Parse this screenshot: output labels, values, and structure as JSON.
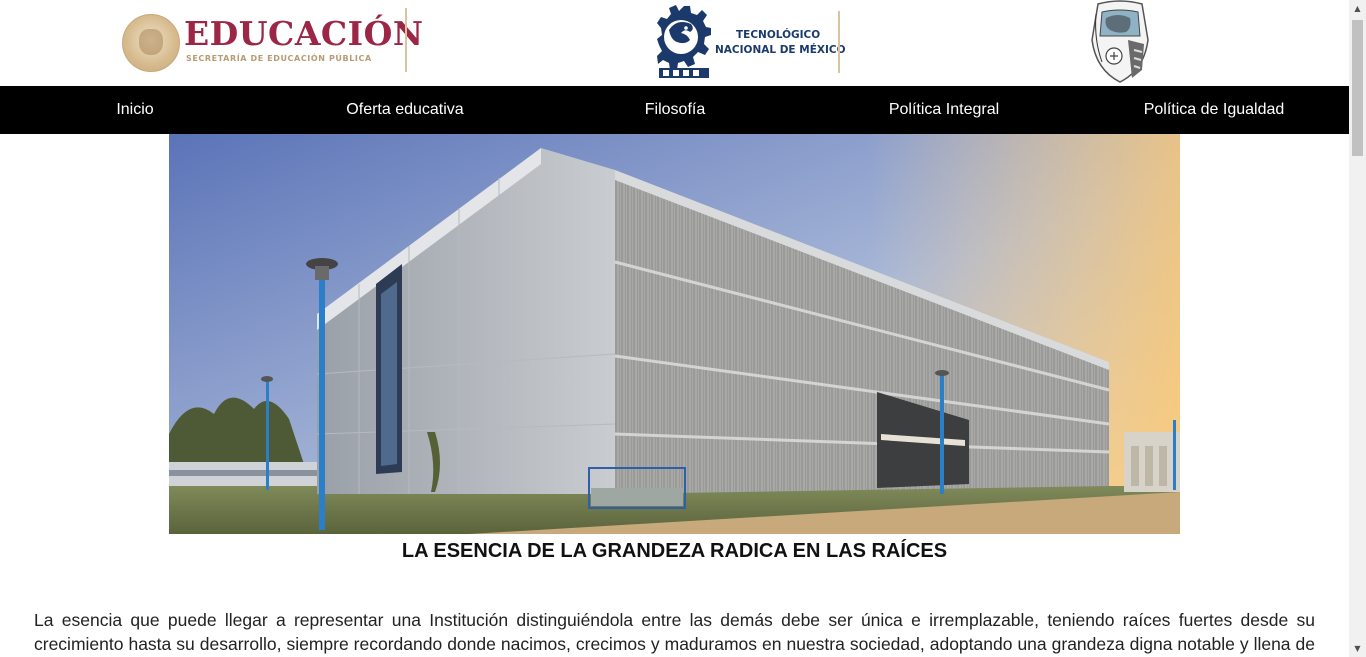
{
  "header": {
    "sep_logo": {
      "title": "EDUCACIÓN",
      "subtitle": "SECRETARÍA DE EDUCACIÓN PÚBLICA"
    },
    "tnm_logo": {
      "line1": "TECNOLÓGICO",
      "line2": "NACIONAL DE MÉXICO"
    }
  },
  "nav": {
    "items": [
      {
        "label": "Inicio"
      },
      {
        "label": "Oferta educativa"
      },
      {
        "label": "Filosofía"
      },
      {
        "label": "Política Integral"
      },
      {
        "label": "Política de Igualdad"
      }
    ]
  },
  "main": {
    "headline": "LA ESENCIA DE LA GRANDEZA RADICA EN LAS RAÍCES",
    "paragraph": "La esencia que puede llegar a representar una Institución distinguiéndola entre las demás debe ser única e irremplazable, teniendo raíces fuertes desde su crecimiento hasta su desarrollo, siempre recordando donde nacimos, crecimos y maduramos en nuestra sociedad, adoptando una grandeza digna notable y llena de orgullo."
  },
  "colors": {
    "nav_bg": "#000000",
    "nav_text": "#ffffff",
    "sep_brand": "#9c2646",
    "sep_gold": "#b79b74",
    "tnm_blue": "#1b3a6b"
  },
  "icons": {
    "sep": "sep-seal-icon",
    "tnm": "tnm-gear-eagle-icon",
    "institute": "institute-emblem-icon"
  }
}
